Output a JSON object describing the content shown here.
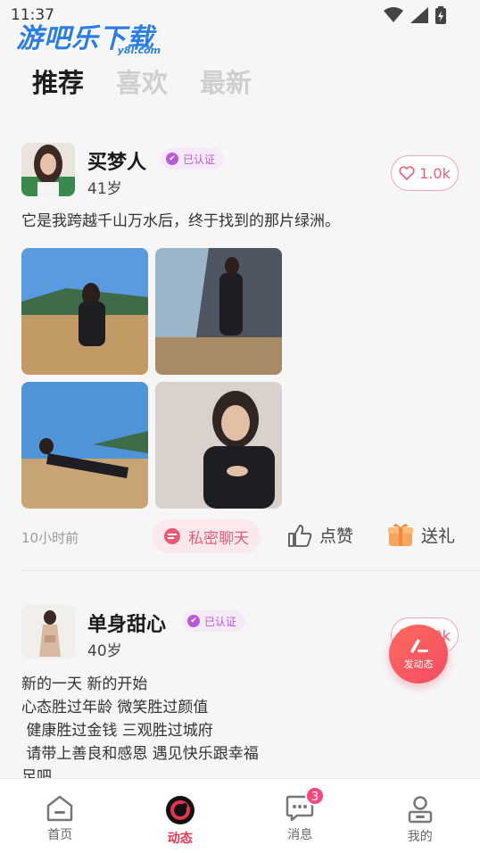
{
  "status_bar": {
    "time": "11:37"
  },
  "watermark": {
    "main": "游吧乐下载",
    "sub": "y8l.com"
  },
  "tabs": [
    {
      "label": "推荐",
      "active": true
    },
    {
      "label": "喜欢",
      "active": false
    },
    {
      "label": "最新",
      "active": false
    }
  ],
  "posts": [
    {
      "name": "买梦人",
      "verified": "已认证",
      "age": "41岁",
      "likes": "1.0k",
      "caption": "它是我跨越千山万水后，终于找到的那片绿洲。",
      "time": "10小时前",
      "chat_label": "私密聊天",
      "like_label": "点赞",
      "gift_label": "送礼"
    },
    {
      "name": "单身甜心",
      "verified": "已认证",
      "age": "40岁",
      "likes": "1.0k",
      "caption_lines": [
        "新的一天 新的开始",
        "心态胜过年龄 微笑胜过颜值",
        " 健康胜过金钱 三观胜过城府",
        " 请带上善良和感恩 遇见快乐跟幸福",
        "足吧"
      ]
    }
  ],
  "fab": {
    "label": "发动态"
  },
  "nav": [
    {
      "label": "首页",
      "icon": "home-icon",
      "active": false
    },
    {
      "label": "动态",
      "icon": "moments-icon",
      "active": true
    },
    {
      "label": "消息",
      "icon": "message-icon",
      "active": false,
      "badge": "3"
    },
    {
      "label": "我的",
      "icon": "profile-icon",
      "active": false
    }
  ],
  "colors": {
    "accent": "#e8344f",
    "badge": "#b65bd4",
    "like": "#ef5b7a"
  }
}
